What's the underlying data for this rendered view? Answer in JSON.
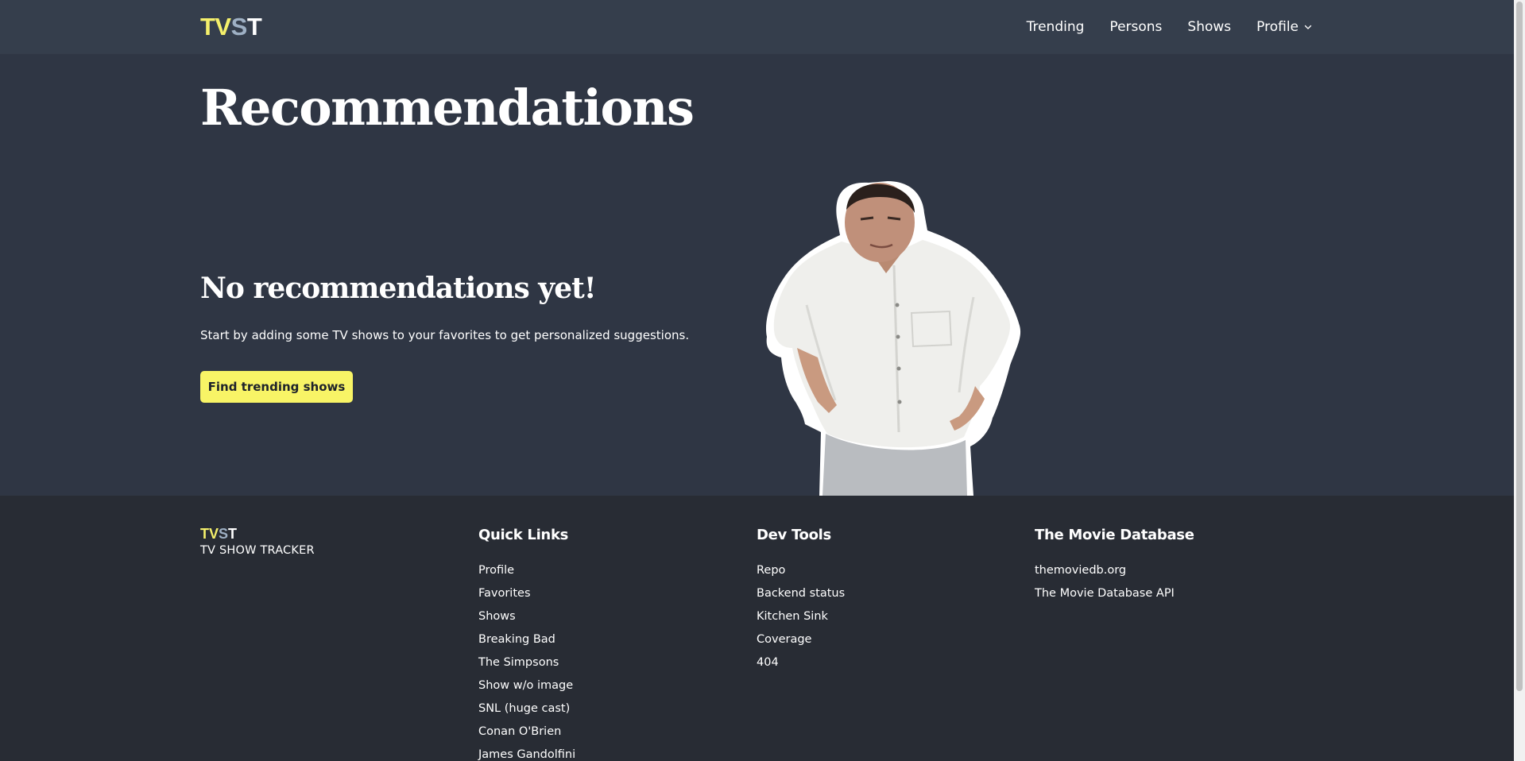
{
  "nav": {
    "logo": {
      "part1": "TV",
      "part2": "S",
      "part3": "T"
    },
    "links": {
      "trending": "Trending",
      "persons": "Persons",
      "shows": "Shows",
      "profile": "Profile"
    }
  },
  "main": {
    "title": "Recommendations",
    "empty_title": "No recommendations yet!",
    "empty_text": "Start by adding some TV shows to your favorites to get personalized suggestions.",
    "cta_label": "Find trending shows"
  },
  "footer": {
    "logo": {
      "part1": "TV",
      "part2": "S",
      "part3": "T"
    },
    "tagline": "TV SHOW TRACKER",
    "quick_links": {
      "heading": "Quick Links",
      "items": [
        "Profile",
        "Favorites",
        "Shows",
        "Breaking Bad",
        "The Simpsons",
        "Show w/o image",
        "SNL (huge cast)",
        "Conan O'Brien",
        "James Gandolfini"
      ]
    },
    "dev_tools": {
      "heading": "Dev Tools",
      "items": [
        "Repo",
        "Backend status",
        "Kitchen Sink",
        "Coverage",
        "404"
      ]
    },
    "tmdb": {
      "heading": "The Movie Database",
      "items": [
        "themoviedb.org",
        "The Movie Database API"
      ]
    }
  },
  "colors": {
    "accent": "#f8f466",
    "nav_bg": "#353e4c",
    "main_bg": "#2f3644",
    "footer_bg": "#282c34"
  }
}
